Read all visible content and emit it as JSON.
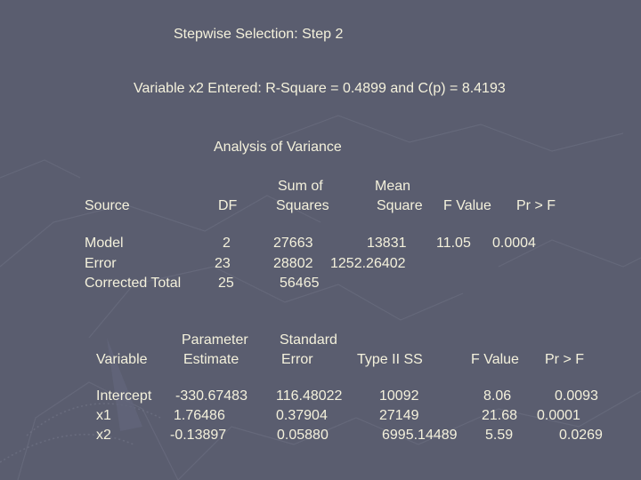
{
  "slide": {
    "title": "Stepwise Selection: Step 2",
    "subtitle": "Variable x2 Entered: R-Square = 0.4899 and C(p) = 8.4193",
    "anova_title": "Analysis of Variance"
  },
  "anova": {
    "headers": {
      "source": "Source",
      "df": "DF",
      "ss_line1": "Sum of",
      "ss_line2": "Squares",
      "ms_line1": "Mean",
      "ms_line2": "Square",
      "fvalue": "F Value",
      "prf": "Pr > F"
    },
    "rows": [
      {
        "source": "Model",
        "df": "2",
        "ss": "27663",
        "ms": "13831",
        "fvalue": "11.05",
        "prf": "0.0004"
      },
      {
        "source": "Error",
        "df": "23",
        "ss": "28802",
        "ms": "1252.26402",
        "fvalue": "",
        "prf": ""
      },
      {
        "source": "Corrected Total",
        "df": "25",
        "ss": "56465",
        "ms": "",
        "fvalue": "",
        "prf": ""
      }
    ]
  },
  "params": {
    "headers": {
      "variable": "Variable",
      "est_line1": "Parameter",
      "est_line2": "Estimate",
      "se_line1": "Standard",
      "se_line2": "Error",
      "type2ss": "Type II SS",
      "fvalue": "F Value",
      "prf": "Pr > F"
    },
    "rows": [
      {
        "variable": "Intercept",
        "estimate": "-330.67483",
        "se": "116.48022",
        "type2ss": "10092",
        "fvalue": "8.06",
        "prf": "0.0093"
      },
      {
        "variable": "x1",
        "estimate": "1.76486",
        "se": "0.37904",
        "type2ss": "27149",
        "fvalue": "21.68",
        "prf": "0.0001"
      },
      {
        "variable": "x2",
        "estimate": "-0.13897",
        "se": "0.05880",
        "type2ss": "6995.14489",
        "fvalue": "5.59",
        "prf": "0.0269"
      }
    ]
  }
}
